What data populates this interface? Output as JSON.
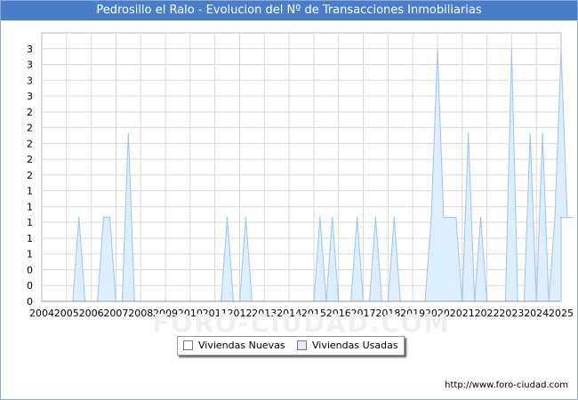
{
  "title": "Pedrosillo el Ralo - Evolucion del Nº de Transacciones Inmobiliarias",
  "url": "http://www.foro-ciudad.com",
  "watermark": "FORO-CIUDAD.COM",
  "colors": {
    "title_bg": "#4a7ec9",
    "series_usadas_fill": "#ddeeff",
    "series_usadas_line": "#9ec3ee",
    "grid": "#d8d8d8"
  },
  "chart_data": {
    "type": "area",
    "title": "Pedrosillo el Ralo - Evolucion del Nº de Transacciones Inmobiliarias",
    "xlim": [
      2004,
      2025
    ],
    "ylim": [
      0,
      3.2
    ],
    "x_ticks": [
      "2004",
      "2005",
      "2006",
      "2007",
      "2008",
      "2009",
      "2010",
      "2011",
      "2012",
      "2013",
      "2014",
      "2015",
      "2016",
      "2017",
      "2018",
      "2019",
      "2020",
      "2021",
      "2022",
      "2023",
      "2024",
      "2025"
    ],
    "y_ticks": [
      "0",
      "0",
      "0",
      "1",
      "1",
      "1",
      "1",
      "1",
      "2",
      "2",
      "2",
      "2",
      "2",
      "3",
      "3",
      "3",
      "3"
    ],
    "grid": true,
    "legend": "bottom-center",
    "series": [
      {
        "name": "Viviendas Nuevas",
        "values": []
      },
      {
        "name": "Viviendas Usadas",
        "points": [
          [
            2004.0,
            0
          ],
          [
            2005.0,
            0
          ],
          [
            2005.25,
            0
          ],
          [
            2005.5,
            1
          ],
          [
            2005.75,
            0
          ],
          [
            2006.0,
            0
          ],
          [
            2006.25,
            0
          ],
          [
            2006.5,
            1
          ],
          [
            2006.75,
            1
          ],
          [
            2007.0,
            0
          ],
          [
            2007.25,
            0
          ],
          [
            2007.5,
            2
          ],
          [
            2007.75,
            0
          ],
          [
            2008.0,
            0
          ],
          [
            2009.0,
            0
          ],
          [
            2010.0,
            0
          ],
          [
            2011.0,
            0
          ],
          [
            2011.25,
            0
          ],
          [
            2011.5,
            1
          ],
          [
            2011.75,
            0
          ],
          [
            2012.0,
            0
          ],
          [
            2012.25,
            1
          ],
          [
            2012.5,
            0
          ],
          [
            2013.0,
            0
          ],
          [
            2014.0,
            0
          ],
          [
            2015.0,
            0
          ],
          [
            2015.25,
            1
          ],
          [
            2015.5,
            0
          ],
          [
            2015.75,
            1
          ],
          [
            2016.0,
            0
          ],
          [
            2016.5,
            0
          ],
          [
            2016.75,
            1
          ],
          [
            2017.0,
            0
          ],
          [
            2017.25,
            0
          ],
          [
            2017.5,
            1
          ],
          [
            2017.75,
            0
          ],
          [
            2018.0,
            0
          ],
          [
            2018.25,
            1
          ],
          [
            2018.5,
            0
          ],
          [
            2019.0,
            0
          ],
          [
            2019.5,
            0
          ],
          [
            2019.75,
            1
          ],
          [
            2020.0,
            3
          ],
          [
            2020.25,
            1
          ],
          [
            2020.5,
            1
          ],
          [
            2020.75,
            1
          ],
          [
            2021.0,
            0
          ],
          [
            2021.25,
            2
          ],
          [
            2021.5,
            0
          ],
          [
            2021.75,
            1
          ],
          [
            2022.0,
            0
          ],
          [
            2022.5,
            0
          ],
          [
            2022.75,
            0
          ],
          [
            2023.0,
            3
          ],
          [
            2023.25,
            0
          ],
          [
            2023.5,
            0
          ],
          [
            2023.75,
            2
          ],
          [
            2024.0,
            0
          ],
          [
            2024.25,
            2
          ],
          [
            2024.5,
            0
          ],
          [
            2024.75,
            1
          ],
          [
            2025.0,
            3
          ],
          [
            2025.25,
            1
          ],
          [
            2025.5,
            1
          ]
        ]
      }
    ]
  }
}
